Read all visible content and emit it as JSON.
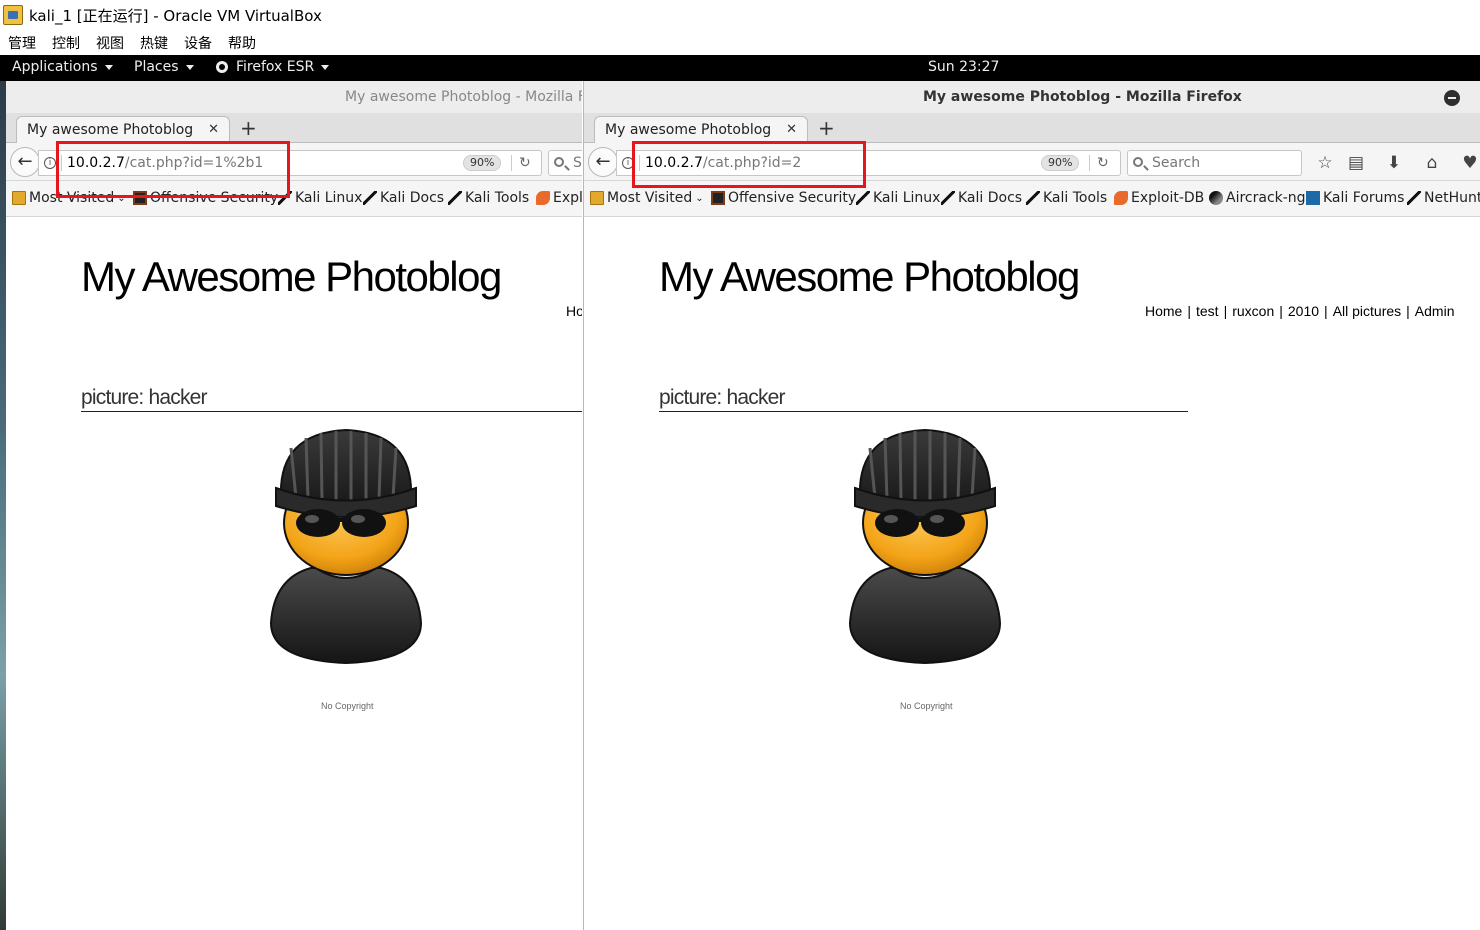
{
  "vbox": {
    "title": "kali_1 [正在运行] - Oracle VM VirtualBox",
    "menu": [
      "管理",
      "控制",
      "视图",
      "热键",
      "设备",
      "帮助"
    ]
  },
  "panel": {
    "applications": "Applications",
    "places": "Places",
    "firefox": "Firefox ESR",
    "clock": "Sun 23:27"
  },
  "left_window": {
    "title": "My awesome Photoblog - Mozilla Fi",
    "tab_label": "My awesome Photoblog",
    "url_host": "10.0.2.7",
    "url_path": "/cat.php?id=1%2b1",
    "zoom": "90%",
    "search_fragment": "S",
    "bookmarks": [
      "Most Visited",
      "Offensive Security",
      "Kali Linux",
      "Kali Docs",
      "Kali Tools",
      "Expl"
    ],
    "page_title": "My Awesome Photoblog",
    "nav_fragment": "Ho",
    "picture_heading": "picture: hacker",
    "copyright": "No Copyright"
  },
  "right_window": {
    "title": "My awesome Photoblog - Mozilla Firefox",
    "tab_label": "My awesome Photoblog",
    "url_host": "10.0.2.7",
    "url_path": "/cat.php?id=2",
    "zoom": "90%",
    "search_placeholder": "Search",
    "bookmarks": [
      "Most Visited",
      "Offensive Security",
      "Kali Linux",
      "Kali Docs",
      "Kali Tools",
      "Exploit-DB",
      "Aircrack-ng",
      "Kali Forums",
      "NetHunt"
    ],
    "page_title": "My Awesome Photoblog",
    "nav": [
      "Home",
      "test",
      "ruxcon",
      "2010",
      "All pictures",
      "Admin"
    ],
    "picture_heading": "picture: hacker",
    "copyright": "No Copyright"
  },
  "colors": {
    "highlight": "#e8141e",
    "panel_bg": "#000000",
    "chrome_bg": "#f5f5f5"
  }
}
